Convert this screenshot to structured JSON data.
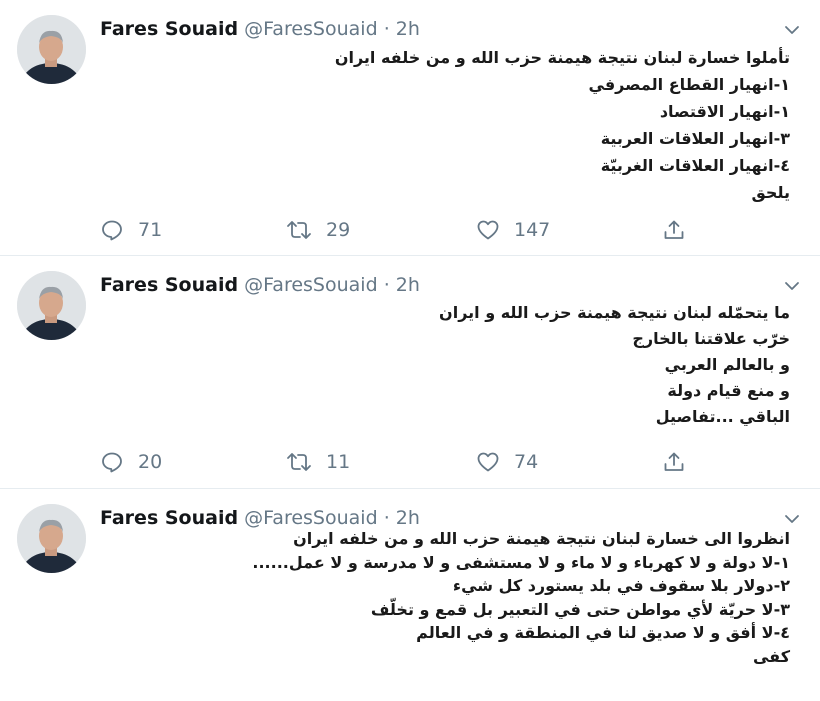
{
  "tweets": [
    {
      "author": "Fares Souaid",
      "handle": "@FaresSouaid",
      "separator": "·",
      "time": "2h",
      "lines": [
        "تأملوا خسارة لبنان نتيجة هيمنة حزب الله و من خلفه ايران",
        "١-انهيار القطاع المصرفي",
        "١-انهيار الاقتصاد",
        "٣-انهيار العلاقات العربية",
        "٤-انهيار العلاقات الغربيّة",
        "يلحق"
      ],
      "replies": "71",
      "retweets": "29",
      "likes": "147"
    },
    {
      "author": "Fares Souaid",
      "handle": "@FaresSouaid",
      "separator": "·",
      "time": "2h",
      "lines": [
        "ما يتحمّله لبنان نتيجة هيمنة حزب الله و ايران",
        "خرّب علاقتنا بالخارج",
        "و بالعالم العربي",
        "و منع قيام دولة",
        "الباقي ...تفاصيل"
      ],
      "replies": "20",
      "retweets": "11",
      "likes": "74"
    },
    {
      "author": "Fares Souaid",
      "handle": "@FaresSouaid",
      "separator": "·",
      "time": "2h",
      "lines": [
        "انظروا الى خسارة لبنان نتيجة هيمنة حزب الله و من خلفه ايران",
        "١-لا دولة و لا كهرباء و لا ماء و لا مستشفى و لا مدرسة و لا عمل......",
        "٢-دولار بلا سقوف في بلد يستورد كل شيء",
        "٣-لا حريّة لأي مواطن حتى في التعبير بل قمع و تخلّف",
        "٤-لا أفق و لا صديق لنا في المنطقة و في العالم",
        "كفى"
      ]
    }
  ],
  "icons": {
    "avatar": "profile-photo",
    "menu": "chevron-down-icon",
    "reply": "reply-icon",
    "retweet": "retweet-icon",
    "like": "heart-icon",
    "share": "share-icon"
  },
  "colors": {
    "text": "#14171a",
    "secondary": "#657786",
    "divider": "#e6ecf0"
  }
}
